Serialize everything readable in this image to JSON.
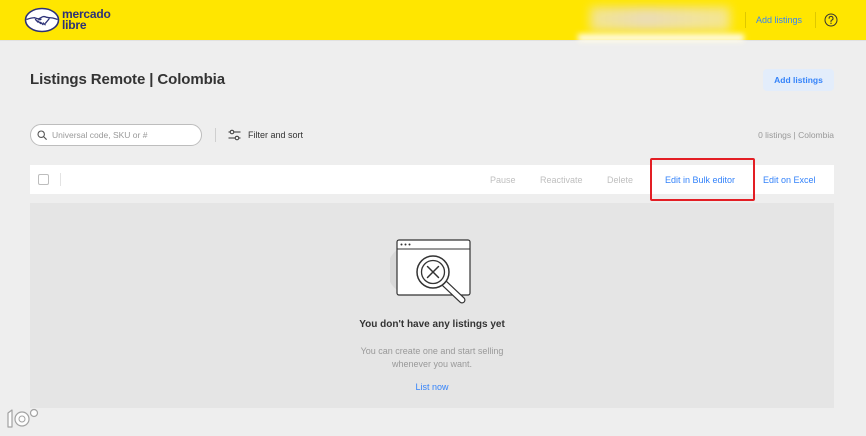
{
  "header": {
    "logo_line1": "mercado",
    "logo_line2": "libre",
    "logo_icon": "handshake-icon",
    "add_listings_link": "Add listings",
    "help_icon": "help-circle-icon"
  },
  "page": {
    "title": "Listings Remote | Colombia",
    "add_listings_button": "Add listings"
  },
  "toolbar": {
    "search": {
      "placeholder": "Universal code, SKU or #",
      "value": "",
      "icon": "search-icon"
    },
    "filter": {
      "label": "Filter and sort",
      "icon": "sliders-icon"
    },
    "summary": "0 listings | Colombia"
  },
  "actions": {
    "select_all_checked": false,
    "items": [
      {
        "label": "Pause",
        "enabled": false,
        "highlighted": false
      },
      {
        "label": "Reactivate",
        "enabled": false,
        "highlighted": false
      },
      {
        "label": "Delete",
        "enabled": false,
        "highlighted": false
      },
      {
        "label": "Edit in Bulk editor",
        "enabled": true,
        "highlighted": true
      },
      {
        "label": "Edit on Excel",
        "enabled": true,
        "highlighted": false
      }
    ]
  },
  "empty_state": {
    "illustration": "browser-search-no-results-illustration",
    "title": "You don't have any listings yet",
    "description": "You can create one and start selling whenever you want.",
    "link": "List now"
  },
  "watermark": {
    "text": "大数跨境"
  },
  "colors": {
    "brand_yellow": "#FFE600",
    "brand_navy": "#2D3277",
    "link_blue": "#3483FA",
    "button_background": "#E3EDFB",
    "highlight_red": "#E31E24",
    "disabled_text": "#BFBFBF",
    "page_background": "#EEEEEE",
    "panel_background": "#E5E5E5"
  }
}
